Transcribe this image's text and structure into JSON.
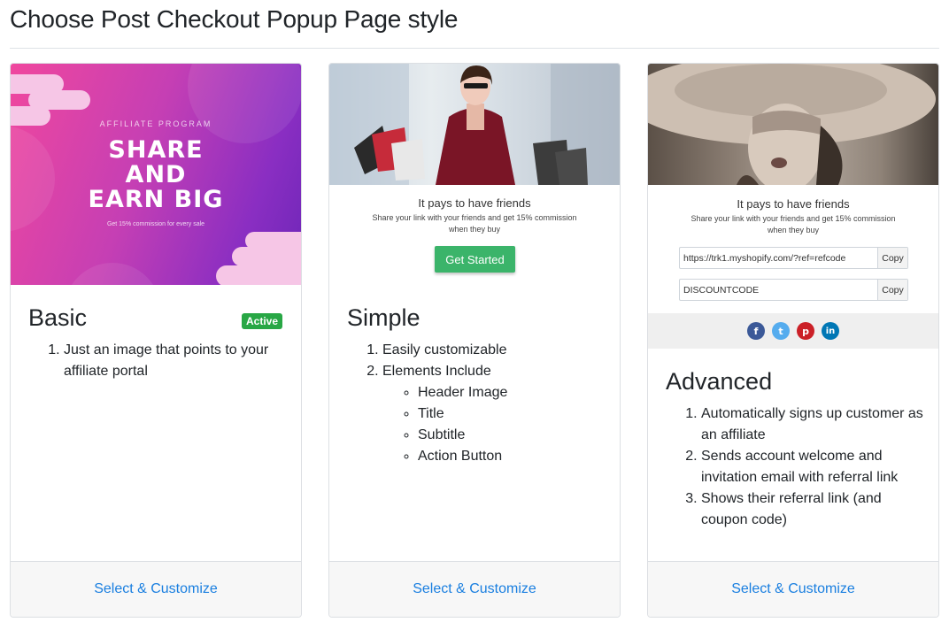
{
  "page": {
    "title": "Choose Post Checkout Popup Page style"
  },
  "colors": {
    "accent_link": "#1a7fe0",
    "active_badge": "#28a745",
    "cta_green": "#3bb46a"
  },
  "cards": [
    {
      "title": "Basic",
      "badge": "Active",
      "banner": {
        "label": "AFFILIATE PROGRAM",
        "headline_1": "SHARE",
        "headline_2": "AND",
        "headline_3": "EARN BIG",
        "subtext": "Get 15% commission for every sale"
      },
      "features": [
        "Just an image that points to your affiliate portal"
      ],
      "select_label": "Select & Customize"
    },
    {
      "title": "Simple",
      "popup": {
        "title": "It pays to have friends",
        "subtitle": "Share your link with your friends and get 15% commission when they buy",
        "button": "Get Started"
      },
      "features": [
        "Easily customizable",
        "Elements Include"
      ],
      "sub_features": [
        "Header Image",
        "Title",
        "Subtitle",
        "Action Button"
      ],
      "select_label": "Select & Customize"
    },
    {
      "title": "Advanced",
      "popup": {
        "title": "It pays to have friends",
        "subtitle": "Share your link with your friends and get 15% commission when they buy",
        "link_value": "https://trk1.myshopify.com/?ref=refcode",
        "code_value": "DISCOUNTCODE",
        "copy_label": "Copy"
      },
      "social": [
        "facebook-icon",
        "twitter-icon",
        "pinterest-icon",
        "linkedin-icon"
      ],
      "features": [
        "Automatically signs up customer as an affiliate",
        "Sends account welcome and invitation email with referral link",
        "Shows their referral link (and coupon code)"
      ],
      "select_label": "Select & Customize"
    }
  ]
}
